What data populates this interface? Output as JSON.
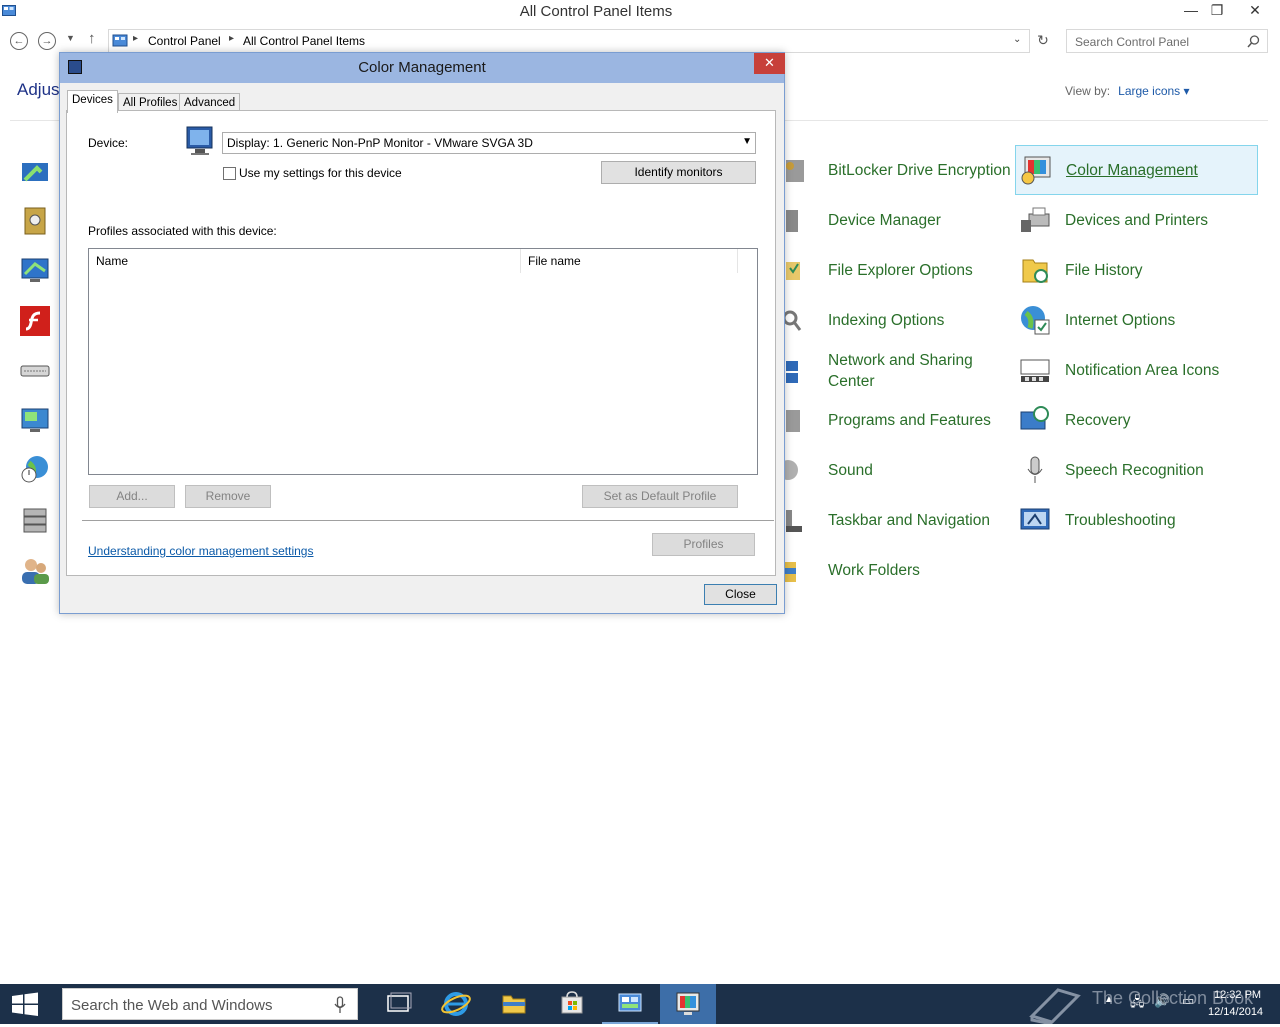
{
  "window": {
    "title": "All Control Panel Items",
    "minimize": "—",
    "restore": "❐",
    "close": "✕"
  },
  "nav": {
    "back": "←",
    "forward": "→",
    "up": "↑",
    "breadcrumb": [
      "Control Panel",
      "All Control Panel Items"
    ],
    "search_placeholder": "Search Control Panel"
  },
  "content": {
    "heading_partial": "Adjust",
    "view_by_label": "View by:",
    "view_by_value": "Large icons ▾",
    "items_col3": [
      "BitLocker Drive Encryption",
      "Device Manager",
      "File Explorer Options",
      "Indexing Options",
      "Network and Sharing Center",
      "Programs and Features",
      "Sound",
      "Taskbar and Navigation",
      "Work Folders"
    ],
    "items_col4": [
      "Color Management",
      "Devices and Printers",
      "File History",
      "Internet Options",
      "Notification Area Icons",
      "Recovery",
      "Speech Recognition",
      "Troubleshooting"
    ]
  },
  "dialog": {
    "title": "Color Management",
    "close_glyph": "✕",
    "tabs": [
      "Devices",
      "All Profiles",
      "Advanced"
    ],
    "device_label": "Device:",
    "device_value": "Display: 1. Generic Non-PnP Monitor - VMware SVGA 3D",
    "use_my_settings": "Use my settings for this device",
    "identify_monitors": "Identify monitors",
    "profiles_label": "Profiles associated with this device:",
    "columns": [
      "Name",
      "File name"
    ],
    "add": "Add...",
    "remove": "Remove",
    "set_default": "Set as Default Profile",
    "understanding_link": "Understanding color management settings",
    "profiles_button": "Profiles",
    "close_button": "Close"
  },
  "taskbar": {
    "search_placeholder": "Search the Web and Windows",
    "time": "12:32 PM",
    "date": "12/14/2014",
    "watermark": "The Collection Book"
  }
}
